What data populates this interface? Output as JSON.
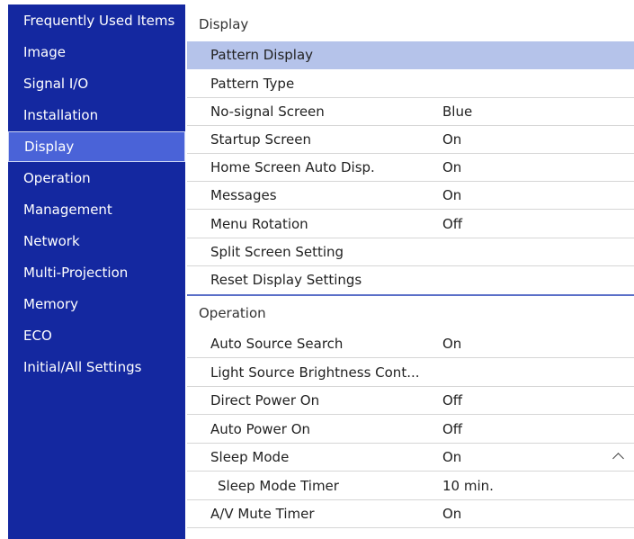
{
  "sidebar": {
    "items": [
      {
        "label": "Frequently Used Items"
      },
      {
        "label": "Image"
      },
      {
        "label": "Signal I/O"
      },
      {
        "label": "Installation"
      },
      {
        "label": "Display",
        "selected": true
      },
      {
        "label": "Operation"
      },
      {
        "label": "Management"
      },
      {
        "label": "Network"
      },
      {
        "label": "Multi-Projection"
      },
      {
        "label": "Memory"
      },
      {
        "label": "ECO"
      },
      {
        "label": "Initial/All Settings"
      }
    ]
  },
  "display_section": {
    "title": "Display",
    "rows": [
      {
        "label": "Pattern Display",
        "value": ""
      },
      {
        "label": "Pattern Type",
        "value": ""
      },
      {
        "label": "No-signal Screen",
        "value": "Blue"
      },
      {
        "label": "Startup Screen",
        "value": "On"
      },
      {
        "label": "Home Screen Auto Disp.",
        "value": "On"
      },
      {
        "label": "Messages",
        "value": "On"
      },
      {
        "label": "Menu Rotation",
        "value": "Off"
      },
      {
        "label": "Split Screen Setting",
        "value": ""
      },
      {
        "label": "Reset Display Settings",
        "value": ""
      }
    ]
  },
  "operation_section": {
    "title": "Operation",
    "rows": [
      {
        "label": "Auto Source Search",
        "value": "On"
      },
      {
        "label": "Light Source Brightness Cont...",
        "value": ""
      },
      {
        "label": "Direct Power On",
        "value": "Off"
      },
      {
        "label": "Auto Power On",
        "value": "Off"
      },
      {
        "label": "Sleep Mode",
        "value": "On"
      },
      {
        "label": "Sleep Mode Timer",
        "value": "10 min."
      },
      {
        "label": "A/V Mute Timer",
        "value": "On"
      }
    ]
  },
  "icons": {
    "expand": "chevron-up-icon"
  },
  "colors": {
    "sidebar_bg": "#1428a0",
    "selected_bg": "#4a63d8",
    "highlight_row": "#b5c3ea",
    "section_rule": "#5a6fc8"
  }
}
